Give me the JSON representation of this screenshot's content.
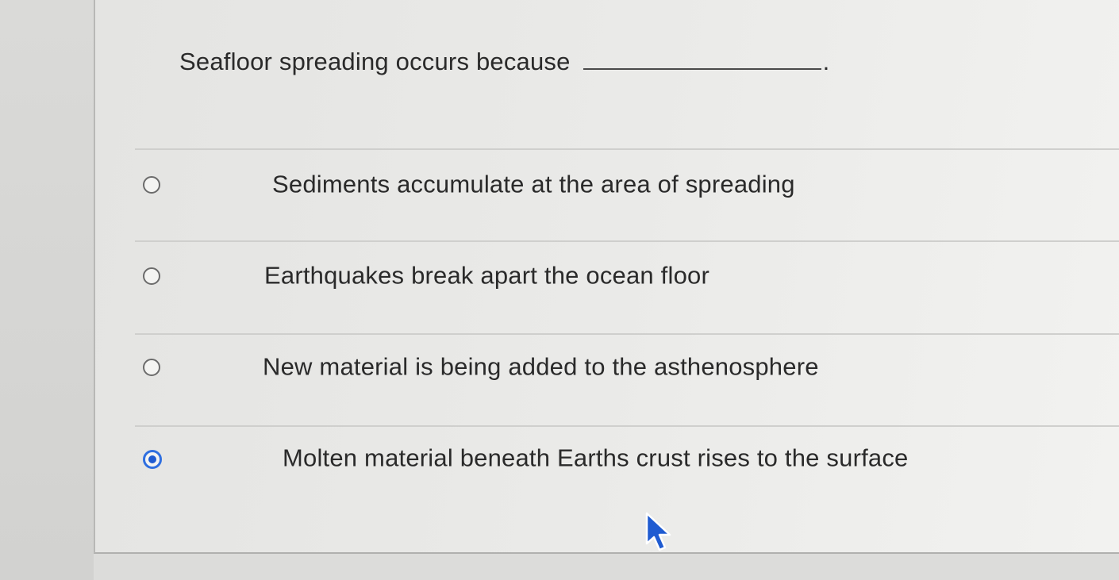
{
  "question": {
    "text": "Seafloor spreading occurs because",
    "period": "."
  },
  "options": [
    {
      "label": "Sediments accumulate at the area of spreading",
      "selected": false
    },
    {
      "label": "Earthquakes break apart the ocean floor",
      "selected": false
    },
    {
      "label": "New material is being added to the asthenosphere",
      "selected": false
    },
    {
      "label": "Molten material beneath Earths crust rises to the surface",
      "selected": true
    }
  ],
  "colors": {
    "radio_selected": "#1f5bd1",
    "text": "#2a2a2a"
  },
  "icons": {
    "cursor": "mouse-pointer-icon"
  }
}
